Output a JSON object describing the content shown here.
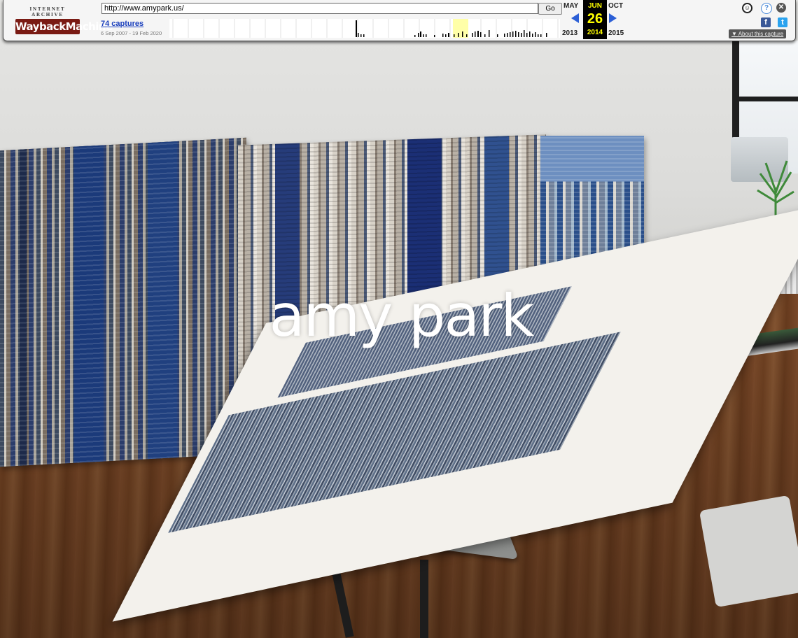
{
  "wayback": {
    "logo_top": "INTERNET ARCHIVE",
    "logo_main": "WaybackMachine",
    "url": "http://www.amypark.us/",
    "go_label": "Go",
    "captures_link": "74 captures",
    "date_range": "6 Sep 2007 - 19 Feb 2020",
    "prev_month": "MAY",
    "current_month": "JUN",
    "next_month": "OCT",
    "current_day": "26",
    "prev_year": "2013",
    "current_year": "2014",
    "next_year": "2015",
    "about_link": "About this capture",
    "icons": {
      "user": "user-icon",
      "help": "help-icon",
      "close": "close-icon",
      "facebook": "facebook-icon",
      "twitter": "twitter-icon",
      "prev": "left-arrow-icon",
      "next": "right-arrow-icon"
    },
    "colors": {
      "accent": "#2c5fd6",
      "highlight_year": "#ffff00",
      "logo_red": "#7a1b14"
    }
  },
  "site": {
    "title": "amy park"
  }
}
